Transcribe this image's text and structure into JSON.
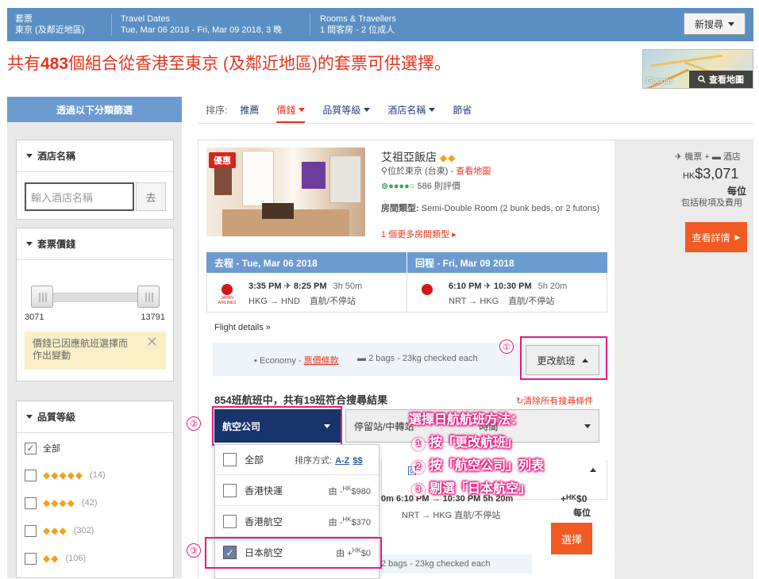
{
  "topbar": {
    "package_label": "套票",
    "package_value": "東京 (及鄰近地區)",
    "dates_label": "Travel Dates",
    "dates_value": "Tue, Mar 06 2018 - Fri, Mar 09 2018, 3 晚",
    "rooms_label": "Rooms & Travellers",
    "rooms_value": "1 間客房 - 2 位成人",
    "new_search": "新搜尋"
  },
  "headline": {
    "prefix": "共有",
    "count": "483",
    "suffix": "個組合從香港至東京 (及鄰近地區)的套票可供選擇。"
  },
  "map": {
    "button": "查看地圖",
    "google": "Google"
  },
  "sidebar": {
    "heading": "透過以下分類篩選",
    "hotel_name": {
      "title": "酒店名稱",
      "placeholder": "輸入酒店名稱",
      "go": "去"
    },
    "price": {
      "title": "套票價錢",
      "min": "3071",
      "max": "13791",
      "min_fraction": 0.0,
      "max_fraction": 1.0,
      "note": "價錢已因應航班選擇而作出變動",
      "close": "✕"
    },
    "quality": {
      "title": "品質等級",
      "items": [
        {
          "label": "全部",
          "checked": true,
          "count": ""
        },
        {
          "label": "◆◆◆◆◆",
          "count": "(14)"
        },
        {
          "label": "◆◆◆◆",
          "count": "(42)"
        },
        {
          "label": "◆◆◆",
          "count": "(302)"
        },
        {
          "label": "◆◆",
          "count": "(106)"
        }
      ]
    }
  },
  "sort": {
    "label": "排序:",
    "options": [
      "推薦",
      "價錢",
      "品質等級",
      "酒店名稱",
      "節省"
    ],
    "active": "價錢"
  },
  "hotel": {
    "promo": "優惠",
    "name": "艾祖亞飯店",
    "stars": "◆◆",
    "location": "位於東京 (台東) -",
    "map_link": "查看地圖",
    "reviews": "586 則評價",
    "room_label": "房間類型:",
    "room_value": "Semi-Double Room (2 bunk beds, or 2 futons)",
    "more_rooms": "1 個更多房間類型"
  },
  "flights": {
    "outbound_head": "去程 - Tue, Mar 06 2018",
    "return_head": "回程 - Fri, Mar 09 2018",
    "airline_logo_text": "JAPAN AIRLINES",
    "outbound": {
      "depart": "3:35 PM",
      "arrive": "8:25 PM",
      "duration": "3h 50m",
      "from": "HKG",
      "to": "HND",
      "type": "直航/不停站"
    },
    "return": {
      "depart": "6:10 PM",
      "arrive": "10:30 PM",
      "duration": "5h 20m",
      "from": "NRT",
      "to": "HKG",
      "type": "直航/不停站"
    },
    "details": "Flight details »",
    "cabin": "Economy -",
    "fare_rules": "票價條款",
    "bags": "2 bags - 23kg checked each",
    "change_flight": "更改航班"
  },
  "filter": {
    "count_line": "854班航班中，共有19班符合搜尋結果",
    "clear_all": "清除所有搜尋條件",
    "airline_dd": "航空公司",
    "stops_dd": "停留站/中轉站",
    "stops_extra": "時間",
    "menu": {
      "all": "全部",
      "sort_label": "排序方式:",
      "sort_az": "A-Z",
      "sort_price": "$$",
      "items": [
        {
          "name": "香港快運",
          "prefix": "由 -",
          "cur": "HK",
          "price": "$980"
        },
        {
          "name": "香港航空",
          "prefix": "由 -",
          "cur": "HK",
          "price": "$370"
        },
        {
          "name": "日本航空",
          "prefix": "由 +",
          "cur": "HK",
          "price": "$0",
          "checked": true
        }
      ]
    }
  },
  "flight2": {
    "cut_head": "回",
    "times": "0m    6:10 PM → 10:30 PM  5h 20m",
    "route": "NRT → HKG",
    "type": "直航/不停站",
    "price_prefix": "+",
    "cur": "HK",
    "price": "$0",
    "per": "每位",
    "select": "選擇",
    "bags": "2 bags - 23kg checked each"
  },
  "price_panel": {
    "includes": "機票 + ",
    "includes2": "酒店",
    "cur": "HK",
    "amount": "$3,071",
    "per": "每位",
    "tax": "包括稅項及費用",
    "view": "查看詳情"
  },
  "annotation": {
    "title": "選擇日航航班方法：",
    "step1": "按「更改航班」",
    "step2": "按「航空公司」列表",
    "step3": "剔選「日本航空」",
    "n1": "①",
    "n2": "②",
    "n3": "③"
  },
  "colors": {
    "accent": "#e8331c",
    "header": "#5b8fc3",
    "filter_blue": "#6b9bd0",
    "navy": "#17356b",
    "orange": "#f15a22",
    "pink": "#e8197d"
  }
}
